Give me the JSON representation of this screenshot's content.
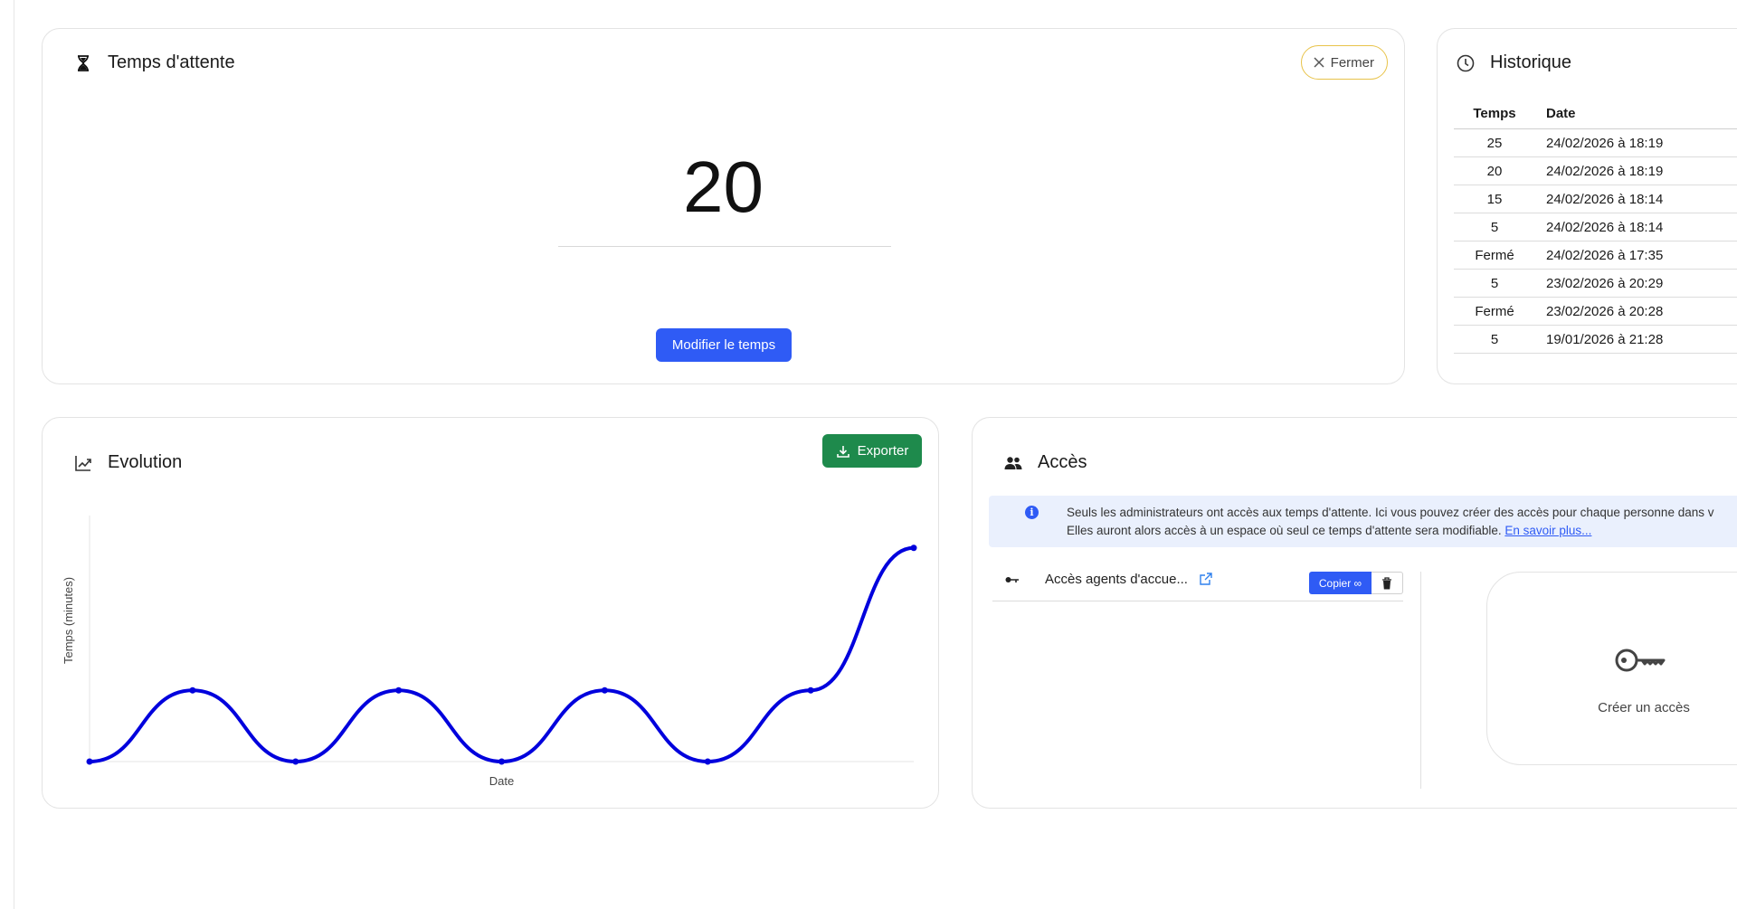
{
  "wait_card": {
    "title": "Temps d'attente",
    "close_label": "Fermer",
    "current_value": "20",
    "modify_label": "Modifier le temps"
  },
  "history": {
    "title": "Historique",
    "headers": [
      "Temps",
      "Date"
    ],
    "rows": [
      [
        "25",
        "24/02/2026 à 18:19"
      ],
      [
        "20",
        "24/02/2026 à 18:19"
      ],
      [
        "15",
        "24/02/2026 à 18:14"
      ],
      [
        "5",
        "24/02/2026 à 18:14"
      ],
      [
        "Fermé",
        "24/02/2026 à 17:35"
      ],
      [
        "5",
        "23/02/2026 à 20:29"
      ],
      [
        "Fermé",
        "23/02/2026 à 20:28"
      ],
      [
        "5",
        "19/01/2026 à 21:28"
      ]
    ]
  },
  "evolution": {
    "title": "Evolution",
    "export_label": "Exporter"
  },
  "chart_data": {
    "type": "line",
    "title": "",
    "xlabel": "Date",
    "ylabel": "Temps (minutes)",
    "color": "#0000dd",
    "x": [
      1,
      2,
      3,
      4,
      5,
      6,
      7,
      8,
      9
    ],
    "values": [
      0,
      5,
      0,
      5,
      0,
      5,
      0,
      5,
      15
    ],
    "ylim": [
      0,
      16
    ],
    "grid": false
  },
  "access": {
    "title": "Accès",
    "info_line1": "Seuls les administrateurs ont accès aux temps d'attente. Ici vous pouvez créer des accès pour chaque personne dans v",
    "info_line2": "Elles auront alors accès à un espace où seul ce temps d'attente sera modifiable.",
    "info_link": "En savoir plus...",
    "item_name": "Accès agents d'accue...",
    "copy_label": "Copier ∞",
    "create_label": "Créer un accès"
  },
  "colors": {
    "primary": "#2f5bf5",
    "export": "#1e8a4c",
    "close_border": "#e8c34a",
    "line": "#0000dd"
  }
}
